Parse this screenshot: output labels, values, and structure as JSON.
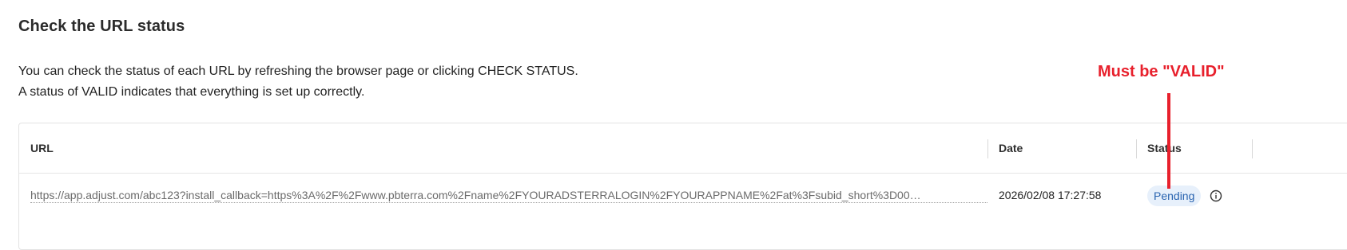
{
  "section": {
    "title": "Check the URL status",
    "description_line1": "You can check the status of each URL by refreshing the browser page or clicking CHECK STATUS.",
    "description_line2": "A status of VALID indicates that everything is set up correctly."
  },
  "table": {
    "columns": [
      "URL",
      "Date",
      "Status"
    ],
    "rows": [
      {
        "url": "https://app.adjust.com/abc123?install_callback=https%3A%2F%2Fwww.pbterra.com%2Fname%2FYOURADSTERRALOGIN%2FYOURAPPNAME%2Fat%3Fsubid_short%3D00…",
        "date": "2026/02/08 17:27:58",
        "status": "Pending"
      }
    ]
  },
  "annotation": {
    "text": "Must be \"VALID\"",
    "color": "#e8202c"
  },
  "icons": {
    "status_info": "info-circle-icon"
  },
  "colors": {
    "status_pill_bg": "#e7f0fb",
    "status_pill_text": "#2a64b0"
  }
}
